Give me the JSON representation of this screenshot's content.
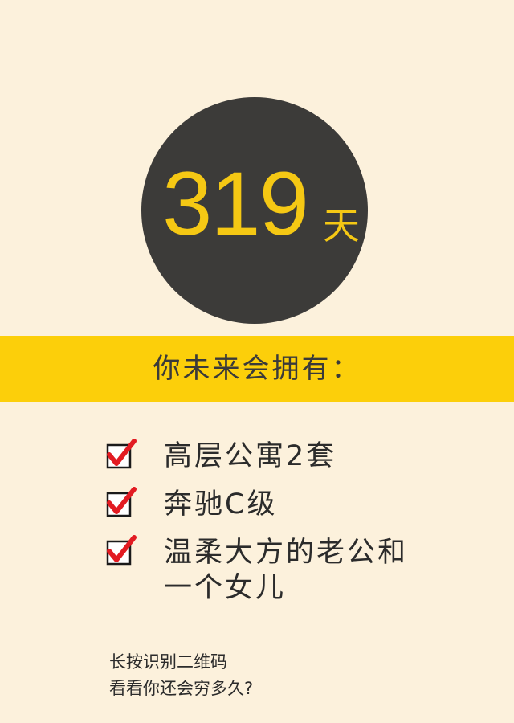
{
  "countdown": {
    "number": "319",
    "unit": "天"
  },
  "banner": {
    "text": "你未来会拥有："
  },
  "items": [
    {
      "line1": "高层公寓2套",
      "line2": ""
    },
    {
      "line1": "奔驰C级",
      "line2": ""
    },
    {
      "line1": "温柔大方的老公和",
      "line2": "一个女儿"
    }
  ],
  "footer": {
    "line1": "长按识别二维码",
    "line2": "看看你还会穷多久?"
  },
  "colors": {
    "background": "#fcf1dc",
    "circle": "#3c3b39",
    "accent": "#fccf0a",
    "number": "#f5c814",
    "check": "#e21b22"
  }
}
